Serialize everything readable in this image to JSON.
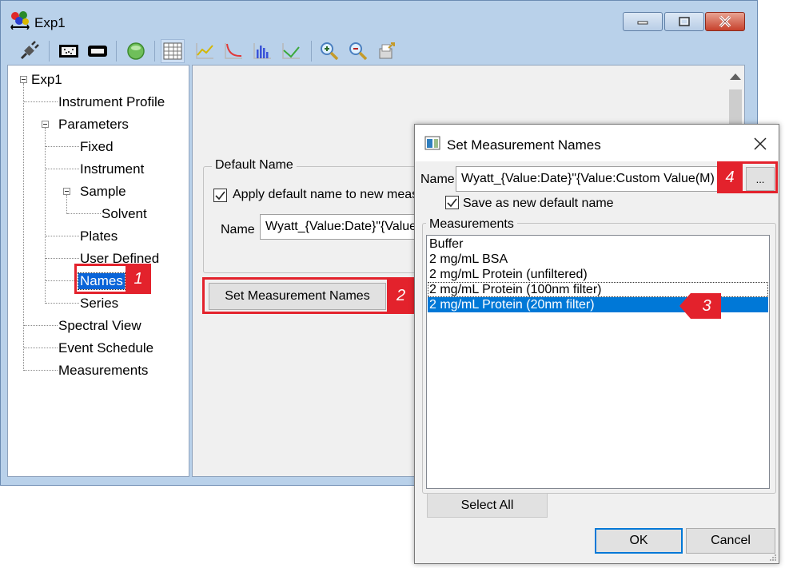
{
  "window": {
    "title": "Exp1"
  },
  "tree": {
    "root": "Exp1",
    "instrument_profile": "Instrument Profile",
    "parameters": "Parameters",
    "fixed": "Fixed",
    "instrument": "Instrument",
    "sample": "Sample",
    "solvent": "Solvent",
    "plates": "Plates",
    "user_defined": "User Defined",
    "names": "Names",
    "series": "Series",
    "spectral_view": "Spectral View",
    "event_schedule": "Event Schedule",
    "measurements": "Measurements",
    "selected_item": "Names"
  },
  "main_panel": {
    "group_title": "Default Name",
    "apply_label": "Apply default name to new meas",
    "apply_checked": true,
    "name_label": "Name",
    "name_value": "Wyatt_{Value:Date}\"{Value",
    "set_names_button": "Set Measurement Names"
  },
  "dialog": {
    "title": "Set Measurement Names",
    "name_label": "Name",
    "name_value": "Wyatt_{Value:Date}\"{Value:Custom Value(M)",
    "browse_button": "...",
    "save_label": "Save as new default name",
    "save_checked": true,
    "measurements_title": "Measurements",
    "measurements": [
      "Buffer",
      "2 mg/mL BSA",
      "2 mg/mL Protein (unfiltered)",
      "2 mg/mL Protein (100nm filter)",
      "2 mg/mL Protein (20nm filter)"
    ],
    "selected_measurement": "2 mg/mL Protein (20nm filter)",
    "select_all_button": "Select All",
    "ok_button": "OK",
    "cancel_button": "Cancel"
  },
  "callouts": {
    "c1": "1",
    "c2": "2",
    "c3": "3",
    "c4": "4"
  },
  "colors": {
    "callout_red": "#e3222c",
    "selection_blue": "#0078d7",
    "window_frame": "#b9d1ea"
  },
  "icons": {
    "app": "app-molecule-icon",
    "toolbar": [
      "connect-plug-icon",
      "instrument-display-icon",
      "cell-icon",
      "run-status-icon",
      "table-view-icon",
      "correlation-graph-icon",
      "decay-graph-icon",
      "histogram-icon",
      "regression-graph-icon",
      "zoom-in-icon",
      "zoom-out-icon",
      "export-icon"
    ]
  }
}
